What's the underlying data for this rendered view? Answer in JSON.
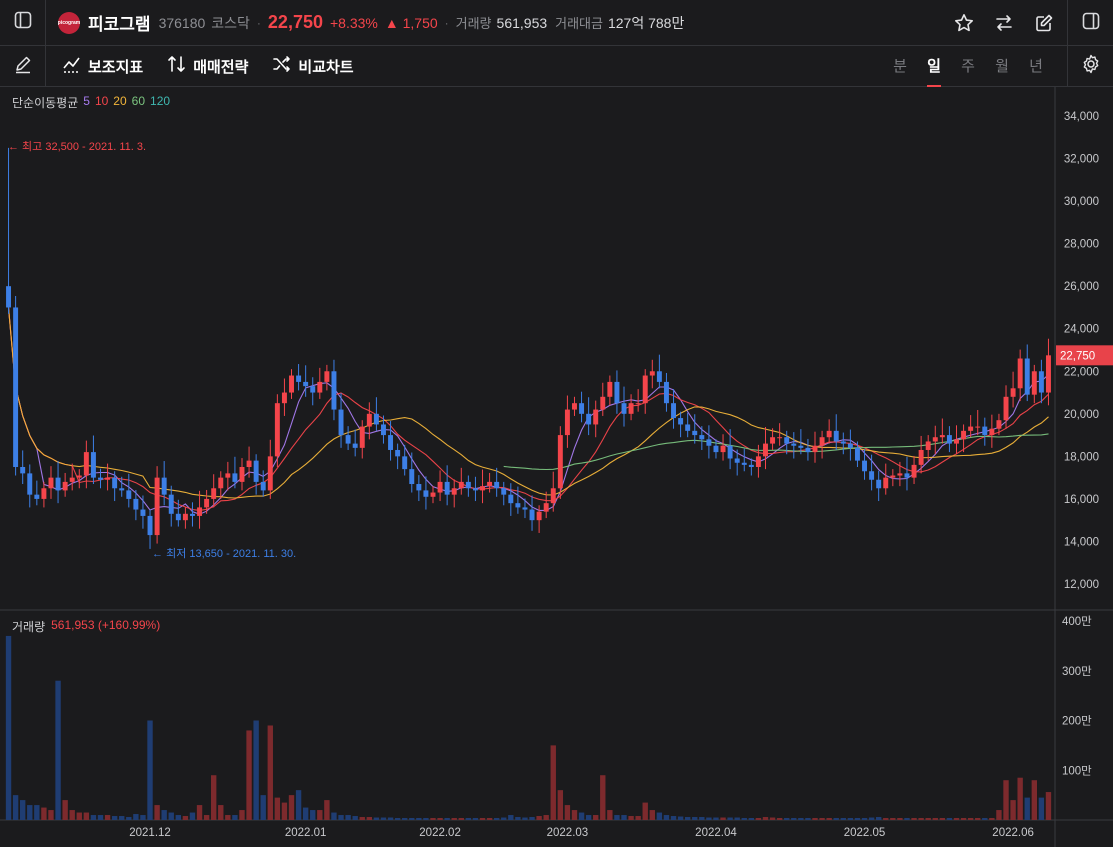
{
  "header": {
    "name": "피코그램",
    "code": "376180",
    "market": "코스닥",
    "price": "22,750",
    "change_pct": "+8.33%",
    "change": "▲ 1,750",
    "volume_label": "거래량",
    "volume": "561,953",
    "amount_label": "거래대금",
    "amount": "127억 788만",
    "logo_text": "picogram"
  },
  "toolbar": {
    "indicators": "보조지표",
    "strategy": "매매전략",
    "compare": "비교차트",
    "periods": [
      "분",
      "일",
      "주",
      "월",
      "년"
    ],
    "active_period": "일"
  },
  "ma_legend": {
    "title": "단순이동평균",
    "items": [
      {
        "label": "5",
        "color": "#a77bf0"
      },
      {
        "label": "10",
        "color": "#f4454b"
      },
      {
        "label": "20",
        "color": "#f2b53a"
      },
      {
        "label": "60",
        "color": "#7bc47f"
      },
      {
        "label": "120",
        "color": "#3fb7b0"
      }
    ]
  },
  "volume_legend": {
    "title": "거래량",
    "value": "561,953 (+160.99%)"
  },
  "annotations": {
    "high": "← 최고 32,500 - 2021. 11. 3.",
    "low": "← 최저 13,650 - 2021. 11. 30."
  },
  "colors": {
    "up": "#f4454b",
    "down": "#3d7fe6",
    "vol_up": "#7d2a2d",
    "vol_down": "#1f3d73",
    "bg": "#1b1b1d",
    "grid": "#2c2d31"
  },
  "chart_data": {
    "type": "candlestick",
    "price_axis": {
      "min": 11000,
      "max": 35000,
      "ticks": [
        12000,
        14000,
        16000,
        18000,
        20000,
        22000,
        24000,
        26000,
        28000,
        30000,
        32000,
        34000
      ],
      "tick_labels": [
        "12,000",
        "14,000",
        "16,000",
        "18,000",
        "20,000",
        "22,000",
        "24,000",
        "26,000",
        "28,000",
        "30,000",
        "32,000",
        "34,000"
      ]
    },
    "volume_axis": {
      "max": 4000000,
      "ticks": [
        1000000,
        2000000,
        3000000,
        4000000
      ],
      "tick_labels": [
        "100만",
        "200만",
        "300만",
        "400만"
      ]
    },
    "x_labels": [
      "2021.12",
      "2022.01",
      "2022.02",
      "2022.03",
      "2022.04",
      "2022.05",
      "2022.06"
    ],
    "x_label_index": [
      20,
      42,
      61,
      79,
      100,
      121,
      142
    ],
    "current_price_label": "22,750",
    "current_price": 22750,
    "high": 32500,
    "low": 13650,
    "closes": [
      25000,
      17500,
      17200,
      16200,
      16000,
      16500,
      17000,
      16400,
      16800,
      17000,
      17100,
      18200,
      17000,
      16900,
      17000,
      16500,
      16400,
      16000,
      15500,
      15200,
      14300,
      17000,
      16200,
      15300,
      15000,
      15300,
      15200,
      15600,
      16000,
      16500,
      17000,
      17200,
      16800,
      17500,
      17800,
      16800,
      16400,
      18000,
      20500,
      21000,
      21800,
      21500,
      21300,
      21000,
      21500,
      22000,
      20200,
      19000,
      18600,
      18400,
      19400,
      20000,
      19500,
      19000,
      18300,
      18000,
      17400,
      16700,
      16400,
      16100,
      16300,
      16800,
      16200,
      16500,
      16800,
      16500,
      16400,
      16600,
      16800,
      16500,
      16200,
      15800,
      15600,
      15500,
      15000,
      15400,
      15800,
      16500,
      19000,
      20200,
      20500,
      20000,
      19500,
      20200,
      20800,
      21500,
      20500,
      20000,
      20500,
      20500,
      21800,
      22000,
      21500,
      20500,
      19800,
      19500,
      19200,
      19000,
      18800,
      18500,
      18200,
      18500,
      17900,
      17700,
      17600,
      17500,
      18000,
      18600,
      18900,
      18900,
      18600,
      18500,
      18400,
      18200,
      18500,
      18900,
      19200,
      18700,
      18600,
      18400,
      17800,
      17300,
      16900,
      16500,
      17000,
      17100,
      17200,
      17000,
      17600,
      18300,
      18700,
      18900,
      19000,
      18600,
      18800,
      19200,
      19400,
      19400,
      19000,
      19300,
      19700,
      20800,
      21200,
      22600,
      20900,
      22000,
      21000,
      22750
    ],
    "volume": [
      3700000,
      500000,
      400000,
      300000,
      300000,
      250000,
      200000,
      2800000,
      400000,
      200000,
      150000,
      150000,
      100000,
      100000,
      100000,
      80000,
      80000,
      60000,
      120000,
      100000,
      2000000,
      300000,
      200000,
      150000,
      100000,
      80000,
      150000,
      300000,
      100000,
      900000,
      300000,
      100000,
      100000,
      200000,
      1800000,
      2000000,
      500000,
      1900000,
      450000,
      350000,
      500000,
      600000,
      250000,
      200000,
      200000,
      400000,
      150000,
      100000,
      100000,
      80000,
      60000,
      60000,
      50000,
      50000,
      50000,
      40000,
      40000,
      40000,
      40000,
      40000,
      40000,
      40000,
      40000,
      40000,
      40000,
      40000,
      40000,
      40000,
      40000,
      40000,
      50000,
      100000,
      60000,
      50000,
      60000,
      80000,
      100000,
      1500000,
      600000,
      300000,
      200000,
      150000,
      100000,
      100000,
      900000,
      200000,
      100000,
      100000,
      80000,
      80000,
      350000,
      200000,
      150000,
      100000,
      80000,
      70000,
      60000,
      60000,
      60000,
      50000,
      50000,
      50000,
      50000,
      50000,
      40000,
      40000,
      40000,
      60000,
      50000,
      40000,
      40000,
      40000,
      40000,
      40000,
      40000,
      40000,
      40000,
      40000,
      40000,
      40000,
      40000,
      40000,
      50000,
      60000,
      40000,
      40000,
      40000,
      40000,
      40000,
      40000,
      40000,
      40000,
      40000,
      40000,
      40000,
      40000,
      40000,
      40000,
      40000,
      40000,
      200000,
      800000,
      400000,
      850000,
      450000,
      800000,
      450000,
      561953
    ]
  }
}
